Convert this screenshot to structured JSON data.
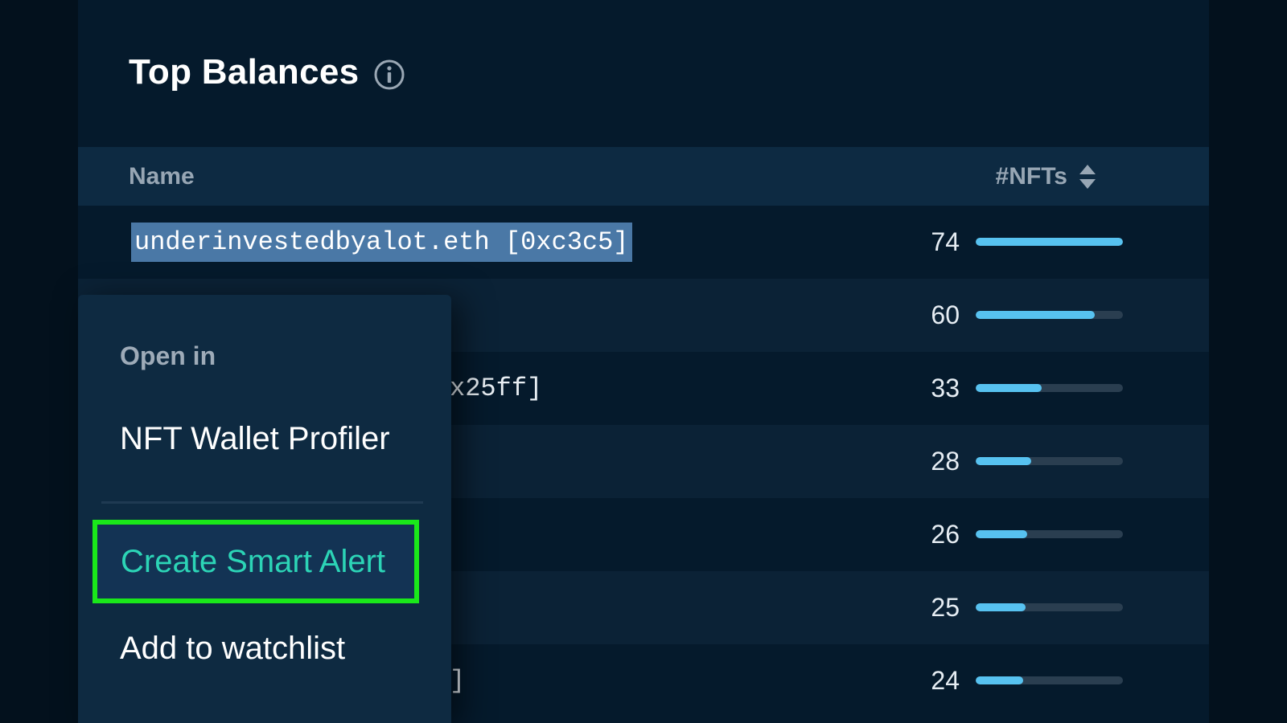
{
  "widget": {
    "title": "Top Balances",
    "info_icon": "info-circle-icon"
  },
  "table": {
    "columns": {
      "name": "Name",
      "nfts": "#NFTs"
    },
    "sort_icon": "sort-arrows-icon",
    "max_value": 74,
    "rows": [
      {
        "name": "underinvestedbyalot.eth [0xc3c5]",
        "name_visible": "underinvestedbyalot.eth [0xc3c5]",
        "selected": true,
        "count": "74",
        "value": 74
      },
      {
        "name_visible": "",
        "count": "60",
        "value": 60
      },
      {
        "name_visible": "x25ff]",
        "count": "33",
        "value": 33
      },
      {
        "name_visible": "",
        "count": "28",
        "value": 28
      },
      {
        "name_visible": "",
        "count": "26",
        "value": 26
      },
      {
        "name_visible": "",
        "count": "25",
        "value": 25
      },
      {
        "name_visible": "]",
        "count": "24",
        "value": 24
      }
    ]
  },
  "context_menu": {
    "header": "Open in",
    "items": {
      "profiler": "NFT Wallet Profiler",
      "smart_alert": "Create Smart Alert",
      "watchlist": "Add to watchlist"
    },
    "highlight_color": "#1ae81a",
    "alert_text_color": "#2cd4b6"
  },
  "colors": {
    "bar_fill": "#57c2f0",
    "bar_track": "#2a3e50",
    "selection": "#4a78a6"
  }
}
